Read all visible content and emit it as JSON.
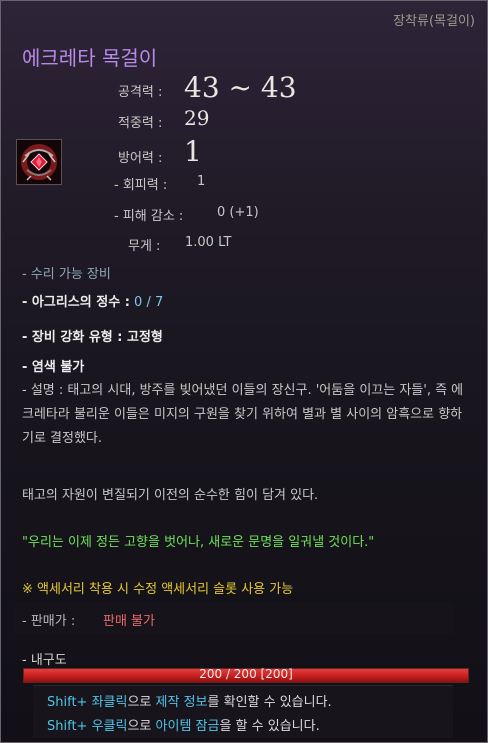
{
  "header": {
    "category": "장착류(목걸이)",
    "item_name": "에크레타 목걸이"
  },
  "icon": {
    "name": "necklace-icon"
  },
  "stats": {
    "attack_label": "공격력 :",
    "attack_value": "43 ~ 43",
    "accuracy_label": "적중력 :",
    "accuracy_value": "29",
    "defense_label": "방어력 :",
    "defense_value": "1",
    "evasion_label": "- 회피력 :",
    "evasion_value": "1",
    "damage_reduction_label": "- 피해 감소 :",
    "damage_reduction_value": "0 (+1)",
    "weight_label": "무게 :",
    "weight_value": "1.00 LT"
  },
  "properties": {
    "repairable": "- 수리 가능 장비",
    "essence_label": "- 아그리스의 정수 :",
    "essence_value": "0 / 7",
    "enhance_type": "- 장비 강화 유형 : 고정형",
    "dye": "- 염색 불가"
  },
  "description": {
    "lore": "- 설명 : 태고의 시대, 방주를 빚어냈던 이들의 장신구. '어둠을 이끄는 자들', 즉 에크레타라 불리운 이들은 미지의 구원을 찾기 위하여 별과 별 사이의 암흑으로 향하기로 결정했다.",
    "note": "태고의 자원이 변질되기 이전의 순수한 힘이 담겨 있다.",
    "quote": "\"우리는 이제 정든 고향을 벗어나, 새로운 문명을 일궈낼 것이다.\"",
    "accessory_note": "※ 액세서리 착용 시 수정 액세서리 슬롯 사용 가능"
  },
  "price": {
    "label": "- 판매가 :",
    "value": "판매 불가"
  },
  "durability": {
    "label": "- 내구도",
    "text": "200 / 200  [200]",
    "fraction": 1.0
  },
  "hints": {
    "line1_key": "Shift+ 좌클릭",
    "line1_mid": "으로 ",
    "line1_target": "제작 정보",
    "line1_end": "를 확인할 수 있습니다.",
    "line2_key": "Shift+ 우클릭",
    "line2_mid": "으로 ",
    "line2_target": "아이템 잠금",
    "line2_end": "을 할 수 있습니다."
  }
}
